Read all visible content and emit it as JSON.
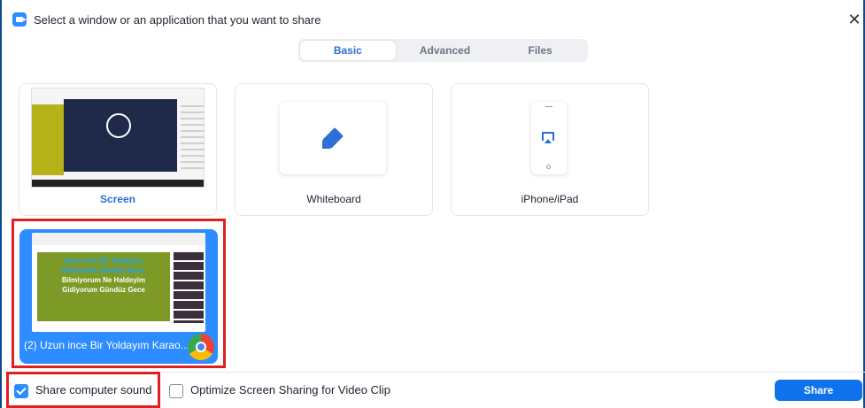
{
  "window": {
    "title": "Select a window or an application that you want to share"
  },
  "tabs": [
    {
      "label": "Basic",
      "active": true
    },
    {
      "label": "Advanced",
      "active": false
    },
    {
      "label": "Files",
      "active": false
    }
  ],
  "options": {
    "screen_label": "Screen",
    "whiteboard_label": "Whiteboard",
    "iphone_label": "iPhone/iPad"
  },
  "selected_window": {
    "label": "(2) Uzun ince Bir Yoldayım Karao...",
    "lyrics": [
      "Uzun ince Bir Yoldayım,",
      "Gidiyorum Gündüz Gece,",
      "Bilmiyorum Ne Haldeyim",
      "Gidiyorum Gündüz Gece"
    ],
    "app_icon": "chrome-icon"
  },
  "footer": {
    "share_sound_label": "Share computer sound",
    "share_sound_checked": true,
    "optimize_label": "Optimize Screen Sharing for Video Clip",
    "optimize_checked": false,
    "share_button": "Share"
  },
  "colors": {
    "accent": "#2d8cff",
    "share_button": "#0e72ed",
    "highlight": "#e02020",
    "tab_active_text": "#2d6ed8"
  }
}
